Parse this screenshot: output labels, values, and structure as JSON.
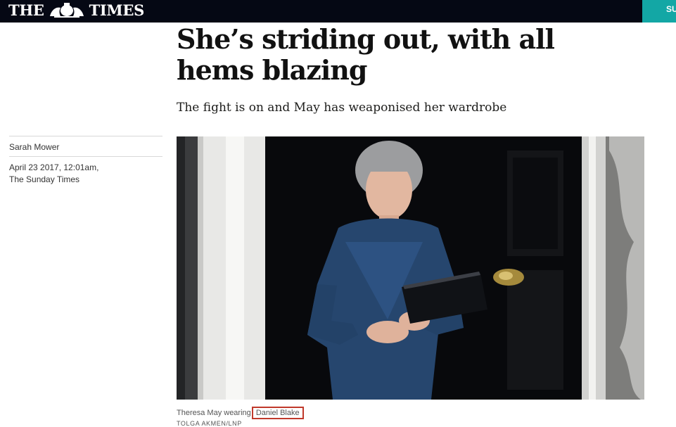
{
  "masthead": {
    "left_word": "THE",
    "right_word": "TIMES",
    "crest_icon": "royal-crest-icon"
  },
  "header": {
    "subscribe_label": "SU"
  },
  "article": {
    "headline": "She’s striding out, with all hems blazing",
    "standfirst": "The fight is on and May has weaponised her wardrobe",
    "author": "Sarah Mower",
    "date": "April 23 2017, 12:01am,",
    "publication": "The Sunday Times"
  },
  "image": {
    "caption_prefix": "Theresa May wearing",
    "caption_highlight": "Daniel Blake",
    "credit": "TOLGA AKMEN/LNP"
  },
  "colors": {
    "topbar": "#050814",
    "subscribe": "#13a7a5",
    "highlight_box": "#c0392b"
  }
}
